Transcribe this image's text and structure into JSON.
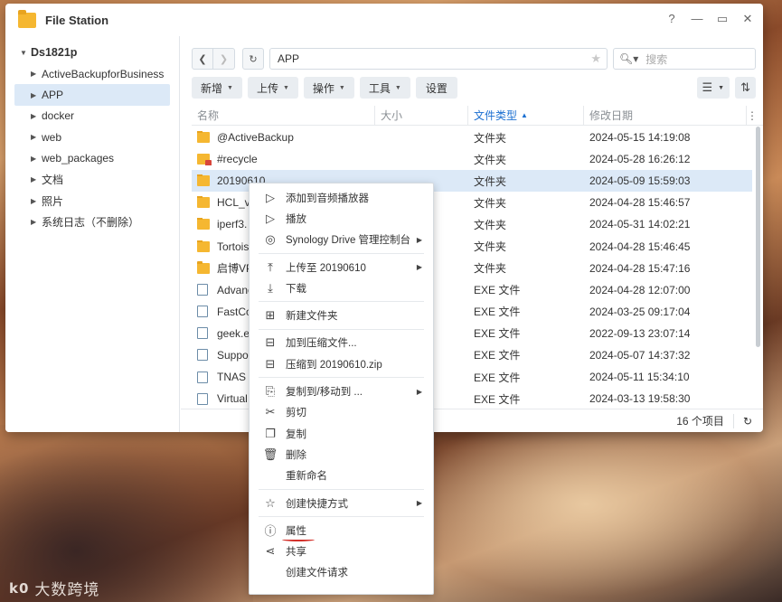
{
  "window": {
    "title": "File Station",
    "controls": [
      "?",
      "—",
      "▭",
      "✕"
    ]
  },
  "sidebar": {
    "root": "Ds1821p",
    "items": [
      {
        "label": "ActiveBackupforBusiness"
      },
      {
        "label": "APP",
        "selected": true
      },
      {
        "label": "docker"
      },
      {
        "label": "web"
      },
      {
        "label": "web_packages"
      },
      {
        "label": "文档"
      },
      {
        "label": "照片"
      },
      {
        "label": "系统日志（不删除）"
      }
    ]
  },
  "nav": {
    "path": "APP",
    "search_placeholder": "搜索"
  },
  "toolbar": {
    "create": "新增",
    "upload": "上传",
    "action": "操作",
    "tools": "工具",
    "settings": "设置"
  },
  "columns": {
    "name": "名称",
    "size": "大小",
    "type": "文件类型",
    "modified": "修改日期"
  },
  "files": [
    {
      "name": "@ActiveBackup",
      "type": "文件夹",
      "date": "2024-05-15 14:19:08",
      "icon": "folder"
    },
    {
      "name": "#recycle",
      "type": "文件夹",
      "date": "2024-05-28 16:26:12",
      "icon": "recycle"
    },
    {
      "name": "20190610",
      "type": "文件夹",
      "date": "2024-05-09 15:59:03",
      "icon": "folder",
      "selected": true
    },
    {
      "name": "HCL_v",
      "type": "文件夹",
      "date": "2024-04-28 15:46:57",
      "icon": "folder"
    },
    {
      "name": "iperf3.",
      "type": "文件夹",
      "date": "2024-05-31 14:02:21",
      "icon": "folder"
    },
    {
      "name": "Tortois",
      "type": "文件夹",
      "date": "2024-04-28 15:46:45",
      "icon": "folder"
    },
    {
      "name": "启博VP",
      "type": "文件夹",
      "date": "2024-04-28 15:47:16",
      "icon": "folder"
    },
    {
      "name": "Advanc",
      "type": "EXE 文件",
      "date": "2024-04-28 12:07:00",
      "icon": "exe"
    },
    {
      "name": "FastCo",
      "type": "EXE 文件",
      "date": "2024-03-25 09:17:04",
      "icon": "exe"
    },
    {
      "name": "geek.e",
      "type": "EXE 文件",
      "date": "2022-09-13 23:07:14",
      "icon": "exe"
    },
    {
      "name": "Suppo",
      "type": "EXE 文件",
      "date": "2024-05-07 14:37:32",
      "icon": "exe"
    },
    {
      "name": "TNAS I",
      "type": "EXE 文件",
      "date": "2024-05-11 15:34:10",
      "icon": "exe"
    },
    {
      "name": "Virtual",
      "type": "EXE 文件",
      "date": "2024-03-13 19:58:30",
      "icon": "exe"
    }
  ],
  "status": {
    "count": "16 个项目"
  },
  "context_menu": {
    "items": [
      {
        "label": "添加到音频播放器",
        "icon": "play-outline-icon"
      },
      {
        "label": "播放",
        "icon": "play-icon"
      },
      {
        "label": "Synology Drive 管理控制台",
        "icon": "synology-drive-icon",
        "submenu": true
      },
      {
        "sep": true
      },
      {
        "label": "上传至 20190610",
        "icon": "upload-icon",
        "submenu": true
      },
      {
        "label": "下载",
        "icon": "download-icon"
      },
      {
        "sep": true
      },
      {
        "label": "新建文件夹",
        "icon": "new-folder-icon"
      },
      {
        "sep": true
      },
      {
        "label": "加到压缩文件...",
        "icon": "archive-icon"
      },
      {
        "label": "压缩到 20190610.zip",
        "icon": "compress-icon"
      },
      {
        "sep": true
      },
      {
        "label": "复制到/移动到 ...",
        "icon": "copy-move-icon",
        "submenu": true
      },
      {
        "label": "剪切",
        "icon": "scissors-icon"
      },
      {
        "label": "复制",
        "icon": "copy-icon"
      },
      {
        "label": "删除",
        "icon": "trash-icon"
      },
      {
        "label": "重新命名",
        "icon": ""
      },
      {
        "sep": true
      },
      {
        "label": "创建快捷方式",
        "icon": "star-icon",
        "submenu": true
      },
      {
        "sep": true
      },
      {
        "label": "属性",
        "icon": "info-icon",
        "underline": true
      },
      {
        "label": "共享",
        "icon": "share-icon"
      },
      {
        "label": "创建文件请求",
        "icon": ""
      }
    ]
  },
  "watermark": {
    "logo": "k0",
    "text": "大数跨境"
  },
  "colors": {
    "accent": "#1b6fd1",
    "selection": "#dce9f7",
    "folder": "#f5b731",
    "annotation": "#d3302a"
  }
}
